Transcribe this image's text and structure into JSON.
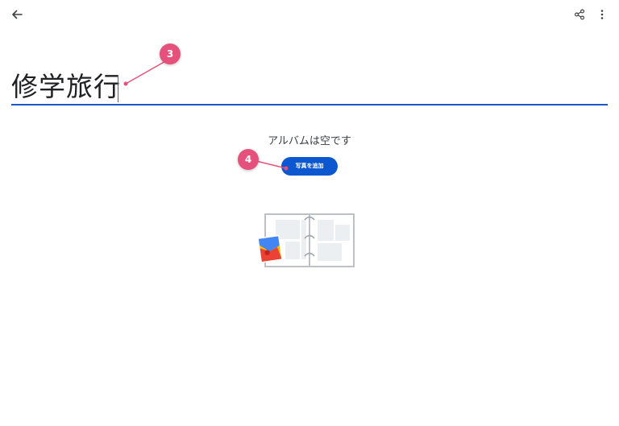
{
  "header": {
    "back_icon": "arrow-back-icon",
    "share_icon": "share-icon",
    "more_icon": "more-vert-icon"
  },
  "album": {
    "title": "修学旅行"
  },
  "empty_state": {
    "message": "アルバムは空です",
    "add_button_label": "写真を追加",
    "illustration_icon": "empty-album-illustration"
  },
  "callouts": [
    {
      "label": "3"
    },
    {
      "label": "4"
    }
  ],
  "colors": {
    "accent": "#0b57d0",
    "underline": "#1a56c7",
    "callout": "#e5517a"
  }
}
